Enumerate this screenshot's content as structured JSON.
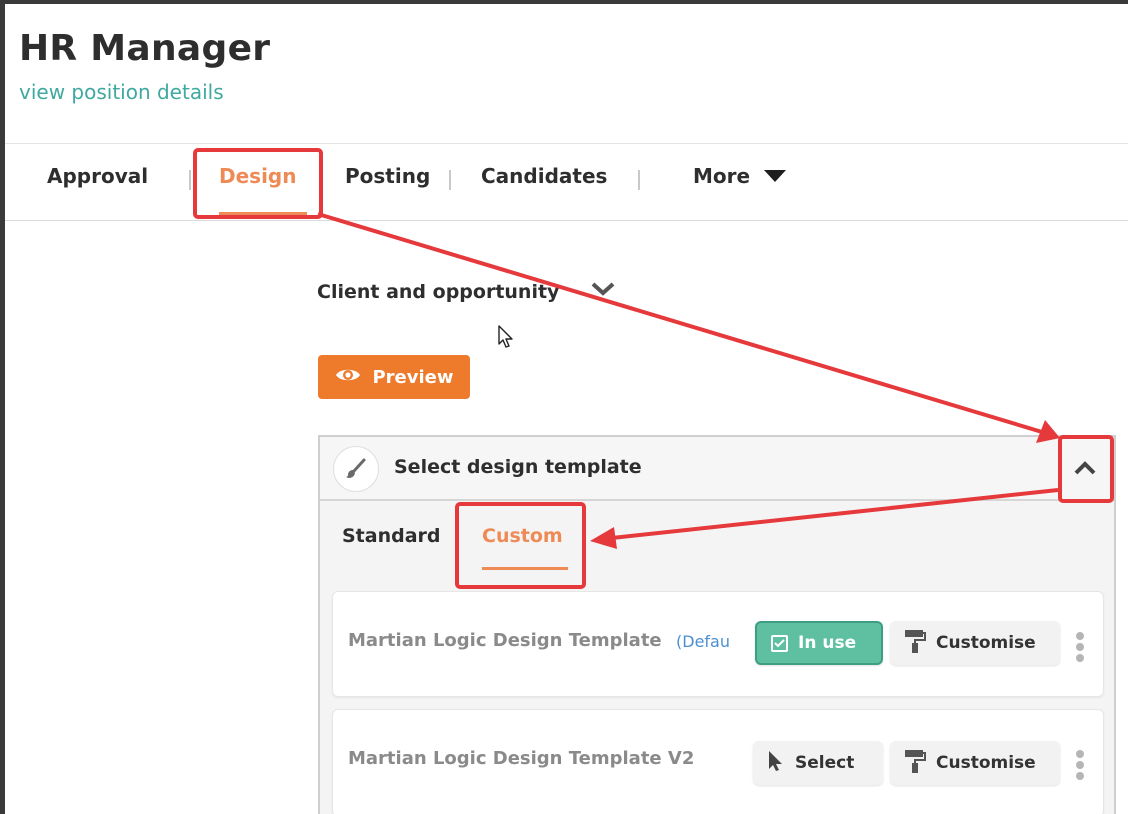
{
  "header": {
    "title": "HR Manager",
    "subtitle_link": "view position details"
  },
  "tabs": [
    {
      "label": "Approval"
    },
    {
      "label": "Design",
      "active": true
    },
    {
      "label": "Posting"
    },
    {
      "label": "Candidates"
    },
    {
      "label": "More",
      "icon": "caret-down-icon"
    }
  ],
  "content": {
    "client_label": "Client and opportunity",
    "preview_label": "Preview"
  },
  "template_panel": {
    "title": "Select design template",
    "subtabs": [
      {
        "label": "Standard"
      },
      {
        "label": "Custom",
        "active": true
      }
    ],
    "templates": [
      {
        "name": "Martian Logic Design Template",
        "default_tag": "(Defau",
        "status_label": "In use",
        "customise_label": "Customise"
      },
      {
        "name": "Martian Logic Design Template V2",
        "select_label": "Select",
        "customise_label": "Customise"
      }
    ]
  },
  "colors": {
    "accent_orange": "#ee7a2b",
    "tab_active": "#ee8a55",
    "link_teal": "#3fa9a0",
    "in_use_green": "#5fc0a1",
    "annotation_red": "#e5393c"
  }
}
